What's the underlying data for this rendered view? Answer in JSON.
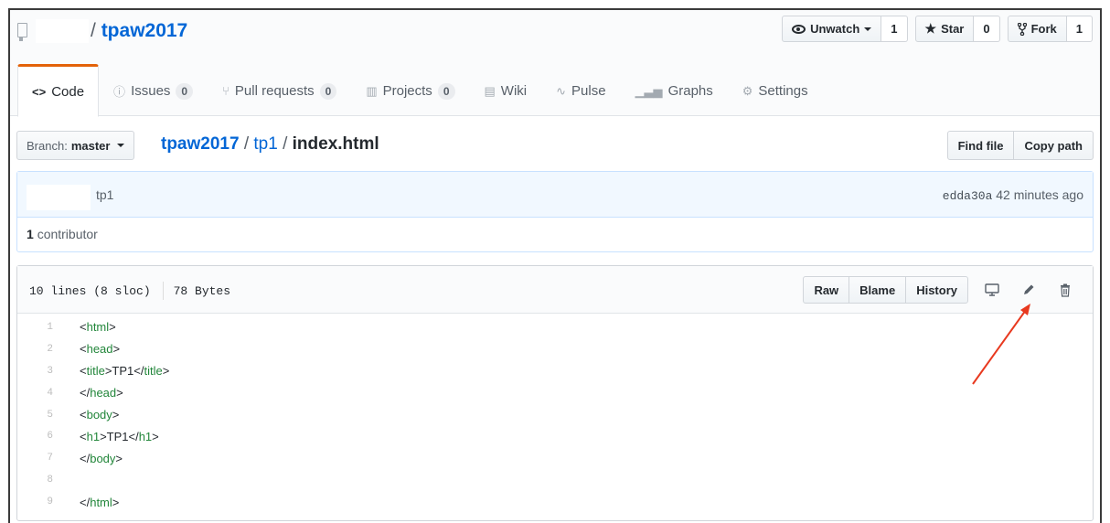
{
  "repo": {
    "name": "tpaw2017",
    "separator": "/"
  },
  "actions": {
    "watch": {
      "label": "Unwatch",
      "count": "1"
    },
    "star": {
      "label": "Star",
      "count": "0"
    },
    "fork": {
      "label": "Fork",
      "count": "1"
    }
  },
  "tabs": [
    {
      "label": "Code",
      "icon": "code-icon"
    },
    {
      "label": "Issues",
      "count": "0",
      "icon": "issue-icon"
    },
    {
      "label": "Pull requests",
      "count": "0",
      "icon": "pull-request-icon"
    },
    {
      "label": "Projects",
      "count": "0",
      "icon": "project-icon"
    },
    {
      "label": "Wiki",
      "icon": "book-icon"
    },
    {
      "label": "Pulse",
      "icon": "pulse-icon"
    },
    {
      "label": "Graphs",
      "icon": "graph-icon"
    },
    {
      "label": "Settings",
      "icon": "gear-icon"
    }
  ],
  "branch": {
    "prefix": "Branch:",
    "name": "master"
  },
  "breadcrumb": {
    "root": "tpaw2017",
    "folder": "tp1",
    "file": "index.html",
    "sep": "/"
  },
  "nav_buttons": {
    "find_file": "Find file",
    "copy_path": "Copy path"
  },
  "commit": {
    "message": "tp1",
    "sha": "edda30a",
    "time": "42 minutes ago"
  },
  "contributors": {
    "count": "1",
    "label": "contributor"
  },
  "file": {
    "lines_info": "10 lines (8 sloc)",
    "size": "78 Bytes",
    "raw": "Raw",
    "blame": "Blame",
    "history": "History"
  },
  "code": [
    {
      "n": "1",
      "pre": "<",
      "tag": "html",
      "post": ">"
    },
    {
      "n": "2",
      "pre": "<",
      "tag": "head",
      "post": ">"
    },
    {
      "n": "3",
      "pre": "<",
      "tag": "title",
      "post": ">TP1</",
      "tag2": "title",
      "post2": ">"
    },
    {
      "n": "4",
      "pre": "</",
      "tag": "head",
      "post": ">"
    },
    {
      "n": "5",
      "pre": "<",
      "tag": "body",
      "post": ">"
    },
    {
      "n": "6",
      "pre": "<",
      "tag": "h1",
      "post": ">TP1</",
      "tag2": "h1",
      "post2": ">"
    },
    {
      "n": "7",
      "pre": "</",
      "tag": "body",
      "post": ">"
    },
    {
      "n": "8",
      "pre": "",
      "tag": "",
      "post": ""
    },
    {
      "n": "9",
      "pre": "</",
      "tag": "html",
      "post": ">"
    }
  ],
  "colors": {
    "accent_tab": "#e36209",
    "link": "#0366d6",
    "annotation_arrow": "#e8391f"
  }
}
